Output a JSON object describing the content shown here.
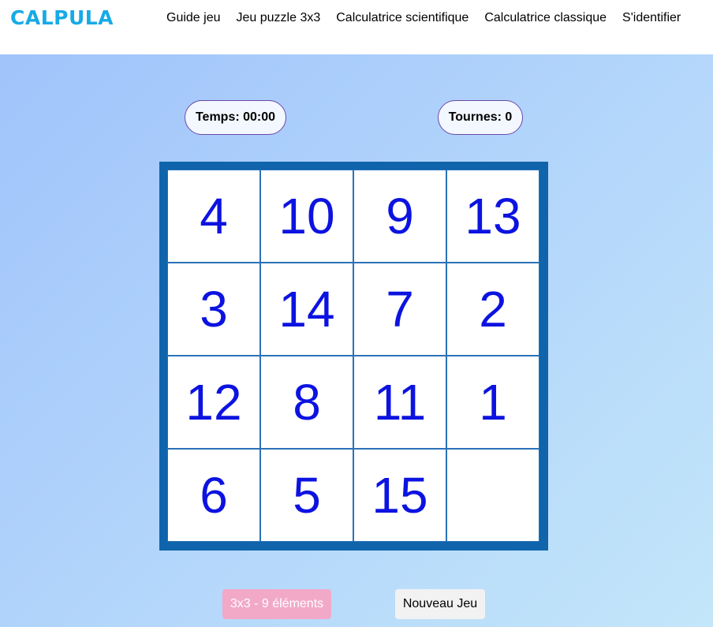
{
  "header": {
    "logo": "CALPULA",
    "nav": [
      {
        "label": "Guide jeu"
      },
      {
        "label": "Jeu puzzle 3x3"
      },
      {
        "label": "Calculatrice scientifique"
      },
      {
        "label": "Calculatrice classique"
      },
      {
        "label": "S'identifier"
      }
    ]
  },
  "stats": {
    "time": "Temps: 00:00",
    "moves": "Tournes: 0"
  },
  "board": {
    "tiles": [
      "4",
      "10",
      "9",
      "13",
      "3",
      "14",
      "7",
      "2",
      "12",
      "8",
      "11",
      "1",
      "6",
      "5",
      "15",
      ""
    ]
  },
  "buttons": {
    "size_label": "3x3 - 9 éléments",
    "new_game_label": "Nouveau Jeu"
  },
  "colors": {
    "logo": "#17aae6",
    "board_frame": "#0f64ab",
    "tile_number": "#0c13e0",
    "size_button": "#f2a9c8"
  }
}
